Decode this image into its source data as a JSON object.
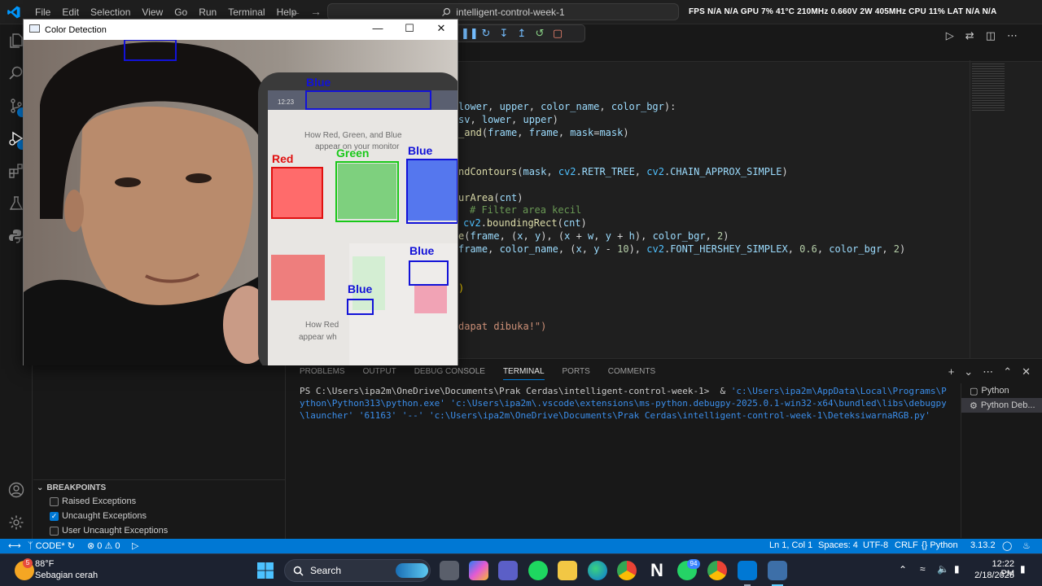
{
  "titlebar": {
    "menu": [
      "File",
      "Edit",
      "Selection",
      "View",
      "Go",
      "Run",
      "Terminal",
      "Help"
    ],
    "search_text": "intelligent-control-week-1",
    "stats": "FPS N/A N/A   GPU 7% 41°C 210MHz 0.660V 2W 405MHz   CPU 11%   LAT N/A N/A"
  },
  "sidebar": {
    "breakpoints_header": "BREAKPOINTS",
    "breakpoints": [
      {
        "label": "Raised Exceptions",
        "checked": false
      },
      {
        "label": "Uncaught Exceptions",
        "checked": true
      },
      {
        "label": "User Uncaught Exceptions",
        "checked": false
      }
    ]
  },
  "editor": {
    "lines": [
      "lower, upper, color_name, color_bgr):",
      "sv, lower, upper)",
      "_and(frame, frame, mask=mask)",
      "ndContours(mask, cv2.RETR_TREE, cv2.CHAIN_APPROX_SIMPLE)",
      "urArea(cnt)",
      "# Filter area kecil",
      "cv2.boundingRect(cnt)",
      "e(frame, (x, y), (x + w, y + h), color_bgr, 2)",
      "frame, color_name, (x, y - 10), cv2.FONT_HERSHEY_SIMPLEX, 0.6, color_bgr, 2)",
      ")",
      "dapat dibuka!\")"
    ]
  },
  "panel": {
    "tabs": [
      "PROBLEMS",
      "OUTPUT",
      "DEBUG CONSOLE",
      "TERMINAL",
      "PORTS",
      "COMMENTS"
    ],
    "active_tab": "TERMINAL",
    "prompt": "PS C:\\Users\\ipa2m\\OneDrive\\Documents\\Prak Cerdas\\intelligent-control-week-1>  & ",
    "command": "'c:\\Users\\ipa2m\\AppData\\Local\\Programs\\Python\\Python313\\python.exe' 'c:\\Users\\ipa2m\\.vscode\\extensions\\ms-python.debugpy-2025.0.1-win32-x64\\bundled\\libs\\debugpy\\launcher' '61163' '--' 'c:\\Users\\ipa2m\\OneDrive\\Documents\\Prak Cerdas\\intelligent-control-week-1\\DeteksiwarnaRGB.py'",
    "terminals": [
      "Python",
      "Python Deb..."
    ]
  },
  "statusbar": {
    "branch": "CODE*",
    "errors": "0",
    "warnings": "0",
    "position": "Ln 1, Col 1",
    "spaces": "Spaces: 4",
    "encoding": "UTF-8",
    "eol": "CRLF",
    "language": "Python",
    "version": "3.13.2",
    "accent": "#0078d4"
  },
  "color_window": {
    "title": "Color Detection",
    "detections": [
      {
        "label": "Blue"
      },
      {
        "label": "Red"
      },
      {
        "label": "Green"
      },
      {
        "label": "Blue"
      },
      {
        "label": "Blue"
      },
      {
        "label": "Blue"
      }
    ],
    "phone_text_1": "How Red, Green, and Blue",
    "phone_text_2": "appear on your monitor",
    "phone_text_3": "How Red",
    "phone_text_4": "appear wh",
    "phone_time": "12:23"
  },
  "taskbar": {
    "weather_temp": "88°F",
    "weather_desc": "Sebagian cerah",
    "weather_badge": "5",
    "search_label": "Search",
    "whatsapp_badge": "94",
    "time": "12:22 PM",
    "date": "2/18/2025"
  }
}
